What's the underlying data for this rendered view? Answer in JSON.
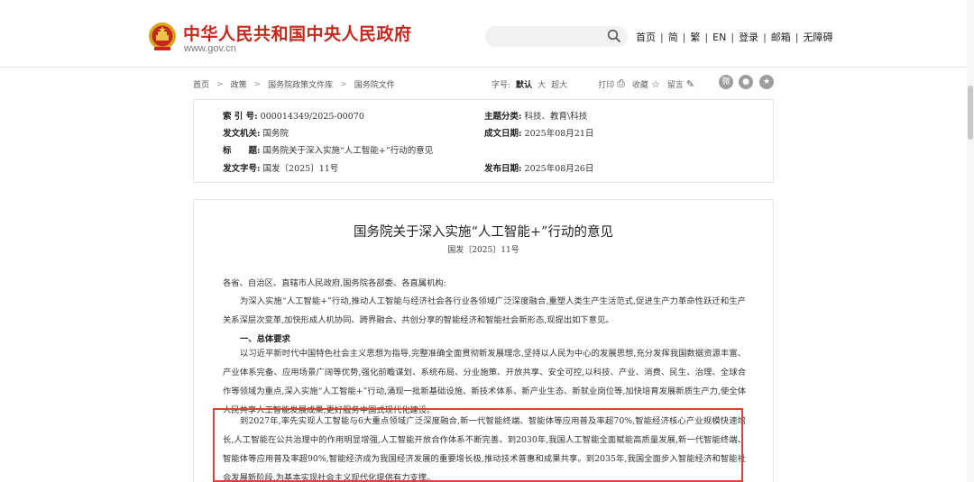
{
  "header": {
    "site_title": "中华人民共和国中央人民政府",
    "site_url": "www.gov.cn",
    "search_placeholder": "",
    "nav": [
      "首页",
      "简",
      "繁",
      "EN",
      "登录",
      "邮箱",
      "无障碍"
    ]
  },
  "breadcrumb": [
    "首页",
    "政策",
    "国务院政策文件库",
    "国务院文件"
  ],
  "tools": {
    "font_size_label": "字号:",
    "font_default": "默认",
    "font_large": "大",
    "font_xlarge": "超大",
    "print": "打印",
    "favorite": "收藏",
    "comment": "留言"
  },
  "share_icons": [
    "weibo-icon",
    "wechat-icon",
    "favorite-star-icon"
  ],
  "meta": {
    "index_no_label": "索 引 号:",
    "index_no": "000014349/2025-00070",
    "topic_label": "主题分类:",
    "topic": "科技、教育\\科技",
    "issuer_label": "发文机关:",
    "issuer": "国务院",
    "written_date_label": "成文日期:",
    "written_date": "2025年08月21日",
    "title_label": "标　　题:",
    "title": "国务院关于深入实施“人工智能+”行动的意见",
    "doc_no_label": "发文字号:",
    "doc_no": "国发〔2025〕11号",
    "publish_date_label": "发布日期:",
    "publish_date": "2025年08月26日"
  },
  "article": {
    "title": "国务院关于深入实施“人工智能+”行动的意见",
    "doc_no": "国发〔2025〕11号",
    "salutation": "各省、自治区、直辖市人民政府,国务院各部委、各直属机构:",
    "intro": "为深入实施“人工智能+”行动,推动人工智能与经济社会各行业各领域广泛深度融合,重塑人类生产生活范式,促进生产力革命性跃迁和生产关系深层次变革,加快形成人机协同、跨界融合、共创分享的智能经济和智能社会新形态,现提出如下意见。",
    "section1_heading": "一、总体要求",
    "section1_para": "以习近平新时代中国特色社会主义思想为指导,完整准确全面贯彻新发展理念,坚持以人民为中心的发展思想,充分发挥我国数据资源丰富、产业体系完备、应用场景广阔等优势,强化前瞻谋划、系统布局、分业施策、开放共享、安全可控,以科技、产业、消费、民生、治理、全球合作等领域为重点,深入实施“人工智能+”行动,涌现一批新基础设施、新技术体系、新产业生态、新就业岗位等,加快培育发展新质生产力,使全体人民共享人工智能发展成果,更好服务中国式现代化建设。",
    "goals_para": "到2027年,率先实现人工智能与6大重点领域广泛深度融合,新一代智能终端、智能体等应用普及率超70%,智能经济核心产业规模快速增长,人工智能在公共治理中的作用明显增强,人工智能开放合作体系不断完善。到2030年,我国人工智能全面赋能高质量发展,新一代智能终端、智能体等应用普及率超90%,智能经济成为我国经济发展的重要增长极,推动技术普惠和成果共享。到2035年,我国全面步入智能经济和智能社会发展新阶段,为基本实现社会主义现代化提供有力支撑。"
  },
  "colors": {
    "brand_red": "#c5281c",
    "highlight_border": "#e0403a"
  }
}
